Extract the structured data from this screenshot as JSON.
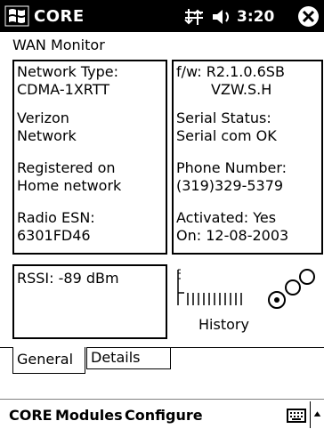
{
  "titlebar": {
    "app_title": "CORE",
    "time": "3:20",
    "start_icon": "windows-flag-icon",
    "connectivity_icon": "connectivity-arrows-icon",
    "volume_icon": "speaker-icon",
    "close_icon": "close-x-icon"
  },
  "screen": {
    "title": "WAN Monitor"
  },
  "left_panel": {
    "network_type_label": "Network Type:",
    "network_type_value": "CDMA-1XRTT",
    "carrier_line1": "Verizon",
    "carrier_line2": "Network",
    "registration_line1": "Registered on",
    "registration_line2": "Home network",
    "esn_label": "Radio ESN:",
    "esn_value": "6301FD46"
  },
  "right_panel": {
    "firmware_line1": "f/w: R2.1.0.6SB",
    "firmware_line2": "VZW.S.H",
    "serial_label": "Serial Status:",
    "serial_value": "Serial com OK",
    "phone_label": "Phone Number:",
    "phone_value": "(319)329-5379",
    "activated_line": "Activated: Yes",
    "activated_on": "On: 12-08-2003"
  },
  "rssi": {
    "text": "RSSI: -89 dBm"
  },
  "history": {
    "label": "History",
    "graph_icon": "signal-history-graph",
    "tool_icon": "history-chain-icon"
  },
  "tabs": [
    {
      "label": "General",
      "selected": true
    },
    {
      "label": "Details",
      "selected": false
    }
  ],
  "menubar": {
    "items": [
      "CORE",
      "Modules",
      "Configure"
    ],
    "keyboard_icon": "keyboard-icon",
    "sip_arrow_icon": "up-arrow-icon"
  }
}
